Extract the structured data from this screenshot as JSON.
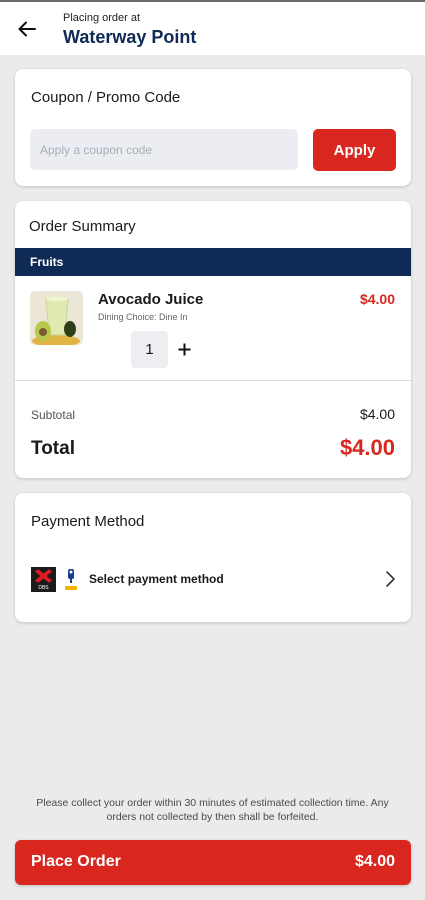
{
  "header": {
    "subtitle": "Placing order at",
    "title": "Waterway Point",
    "back_icon": "arrow-left-icon"
  },
  "coupon": {
    "title": "Coupon / Promo Code",
    "placeholder": "Apply a coupon code",
    "value": "",
    "apply_label": "Apply"
  },
  "order_summary": {
    "title": "Order Summary",
    "category": "Fruits",
    "items": [
      {
        "name": "Avocado Juice",
        "dining_choice": "Dining Choice: Dine In",
        "price": "$4.00",
        "quantity": "1",
        "image_icon": "avocado-juice-image"
      }
    ],
    "subtotal_label": "Subtotal",
    "subtotal_value": "$4.00",
    "total_label": "Total",
    "total_value": "$4.00"
  },
  "payment": {
    "title": "Payment Method",
    "select_label": "Select payment method",
    "icons": [
      "dbs-icon",
      "paylah-icon",
      "chevron-right-icon"
    ]
  },
  "notice": "Please collect your order within 30 minutes of estimated collection time. Any orders not collected by then shall be forfeited.",
  "place_order": {
    "label": "Place Order",
    "total": "$4.00"
  },
  "colors": {
    "brand_red": "#d9261f",
    "navy": "#0f2a55",
    "background": "#ebebeb"
  }
}
